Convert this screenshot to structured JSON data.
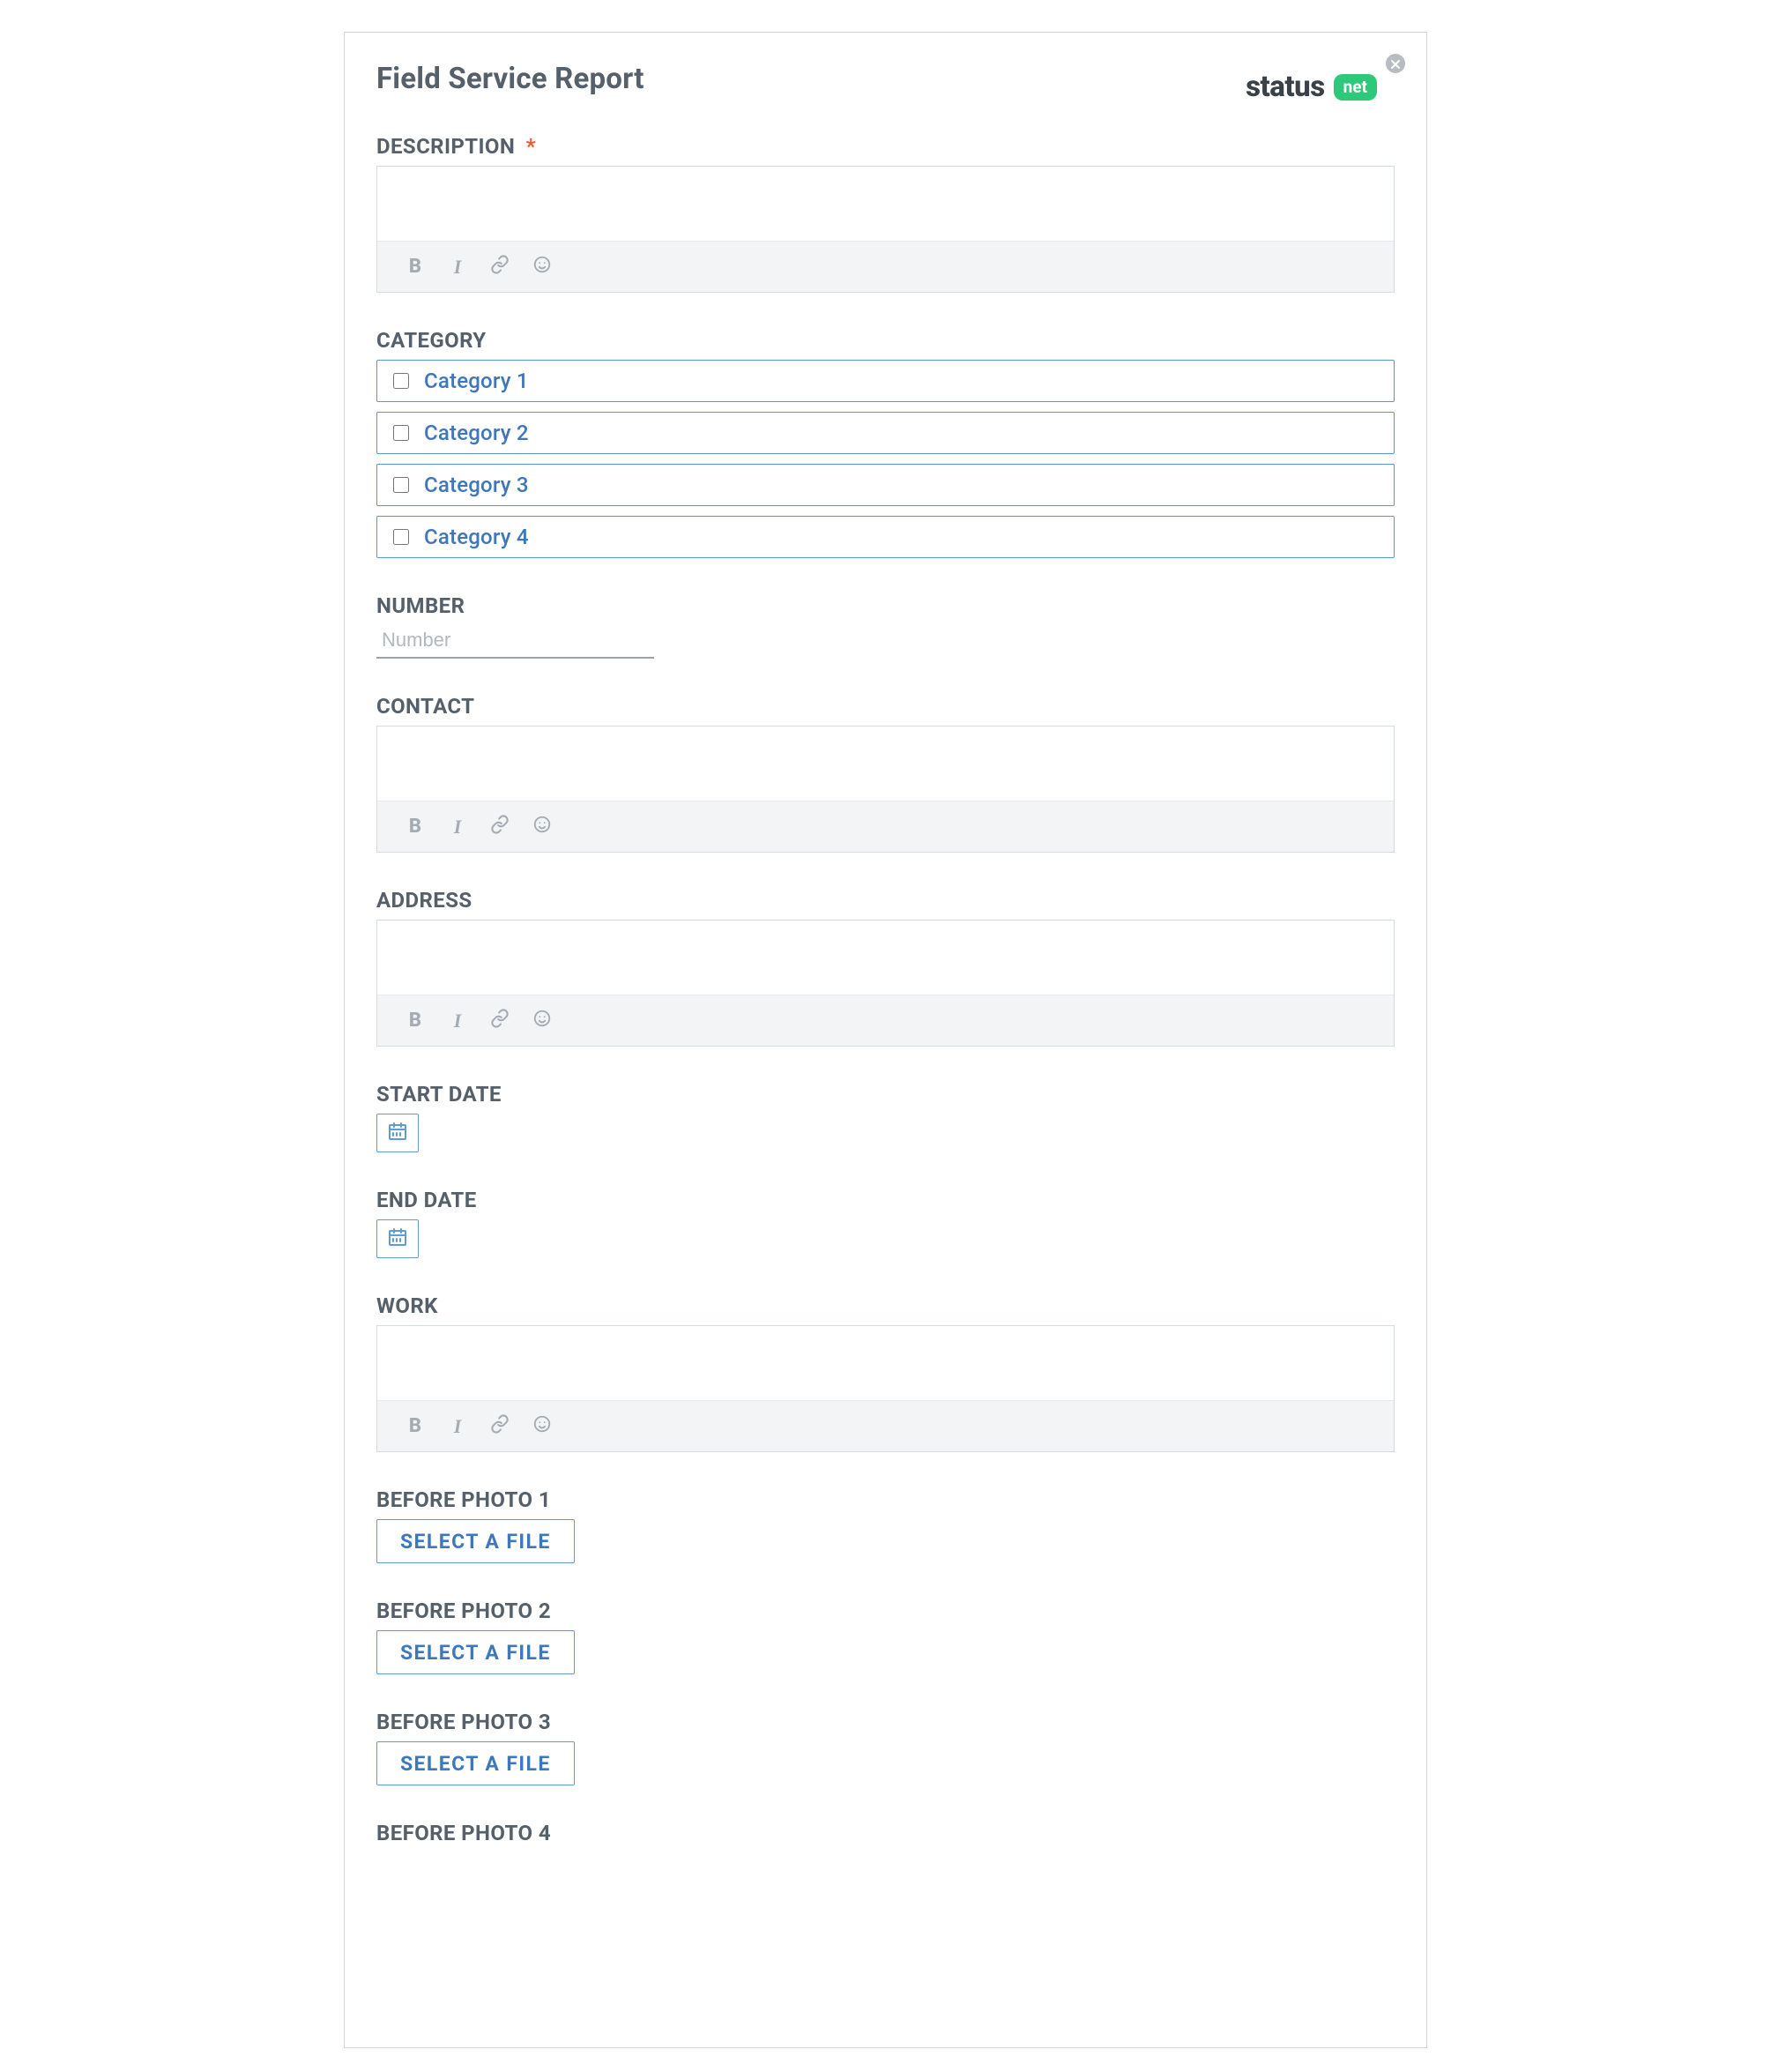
{
  "title": "Field Service Report",
  "brand": {
    "status": "status",
    "net": "net"
  },
  "labels": {
    "description": "DESCRIPTION",
    "category": "CATEGORY",
    "number": "NUMBER",
    "contact": "CONTACT",
    "address": "ADDRESS",
    "start_date": "START DATE",
    "end_date": "END DATE",
    "work": "WORK",
    "before_photo_1": "BEFORE PHOTO 1",
    "before_photo_2": "BEFORE PHOTO 2",
    "before_photo_3": "BEFORE PHOTO 3",
    "before_photo_4": "BEFORE PHOTO 4"
  },
  "required_mark": "*",
  "number_placeholder": "Number",
  "categories": [
    {
      "label": "Category 1"
    },
    {
      "label": "Category 2"
    },
    {
      "label": "Category 3"
    },
    {
      "label": "Category 4"
    }
  ],
  "file_button_label": "SELECT A FILE"
}
